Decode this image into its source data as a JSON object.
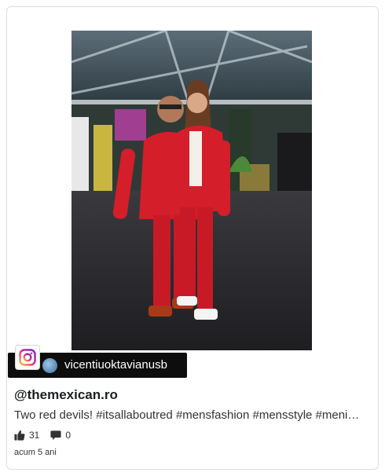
{
  "post": {
    "username": "vicentiuoktavianusb",
    "account": "@themexican.ro",
    "caption": "Two red devils! #itsallaboutred #mensfashion #mensstyle #meni…",
    "likes": "31",
    "comments": "0",
    "timestamp": "acum 5 ani"
  },
  "icons": {
    "instagram": "instagram-icon",
    "like": "thumbs-up-icon",
    "comment": "comment-icon"
  },
  "colors": {
    "suit_red": "#d41e2a",
    "pill_bg": "#0d0d0d"
  }
}
